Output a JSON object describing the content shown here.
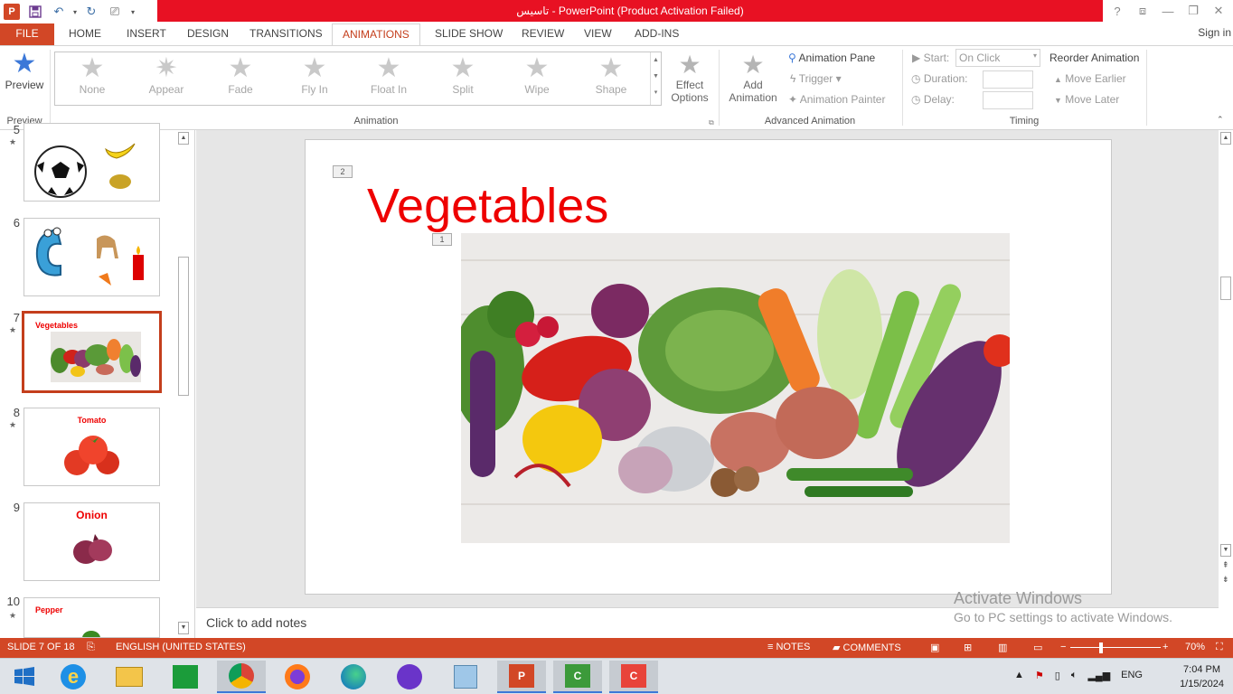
{
  "app": {
    "title": "تاسيس  -  PowerPoint (Product Activation Failed)",
    "logo_letter": "P"
  },
  "window_controls": {
    "help": "?",
    "ribbon_display": "⧈",
    "minimize": "—",
    "restore": "❐",
    "close": "✕"
  },
  "tabs": [
    {
      "label": "FILE"
    },
    {
      "label": "HOME"
    },
    {
      "label": "INSERT"
    },
    {
      "label": "DESIGN"
    },
    {
      "label": "TRANSITIONS"
    },
    {
      "label": "ANIMATIONS"
    },
    {
      "label": "SLIDE SHOW"
    },
    {
      "label": "REVIEW"
    },
    {
      "label": "VIEW"
    },
    {
      "label": "ADD-INS"
    }
  ],
  "signin": "Sign in",
  "ribbon": {
    "preview": {
      "label": "Preview",
      "group": "Preview"
    },
    "animation_group": "Animation",
    "gallery": [
      "None",
      "Appear",
      "Fade",
      "Fly In",
      "Float In",
      "Split",
      "Wipe",
      "Shape"
    ],
    "effect_options": [
      "Effect",
      "Options"
    ],
    "add_animation": [
      "Add",
      "Animation"
    ],
    "animation_pane": "Animation Pane",
    "trigger": "Trigger",
    "animation_painter": "Animation Painter",
    "advanced_group": "Advanced Animation",
    "start_label": "Start:",
    "start_value": "On Click",
    "duration_label": "Duration:",
    "delay_label": "Delay:",
    "reorder_title": "Reorder Animation",
    "move_earlier": "Move Earlier",
    "move_later": "Move Later",
    "timing_group": "Timing"
  },
  "slides": [
    {
      "num": "5",
      "title": ""
    },
    {
      "num": "6",
      "title": ""
    },
    {
      "num": "7",
      "title": "Vegetables"
    },
    {
      "num": "8",
      "title": "Tomato"
    },
    {
      "num": "9",
      "title": "Onion"
    },
    {
      "num": "10",
      "title": "Pepper"
    }
  ],
  "slide": {
    "title": "Vegetables",
    "anim_tags": [
      "2",
      "1"
    ]
  },
  "notes_placeholder": "Click to add notes",
  "watermark": {
    "line1": "Activate Windows",
    "line2": "Go to PC settings to activate Windows."
  },
  "status": {
    "slide_of": "SLIDE 7 OF 18",
    "language": "ENGLISH (UNITED STATES)",
    "notes": "NOTES",
    "comments": "COMMENTS",
    "zoom": "70%"
  },
  "taskbar": {
    "lang": "ENG",
    "time": "7:04 PM",
    "date": "1/15/2024"
  },
  "colors": {
    "accent": "#d24726",
    "title_red": "#e00000",
    "alert_red": "#e81123"
  }
}
